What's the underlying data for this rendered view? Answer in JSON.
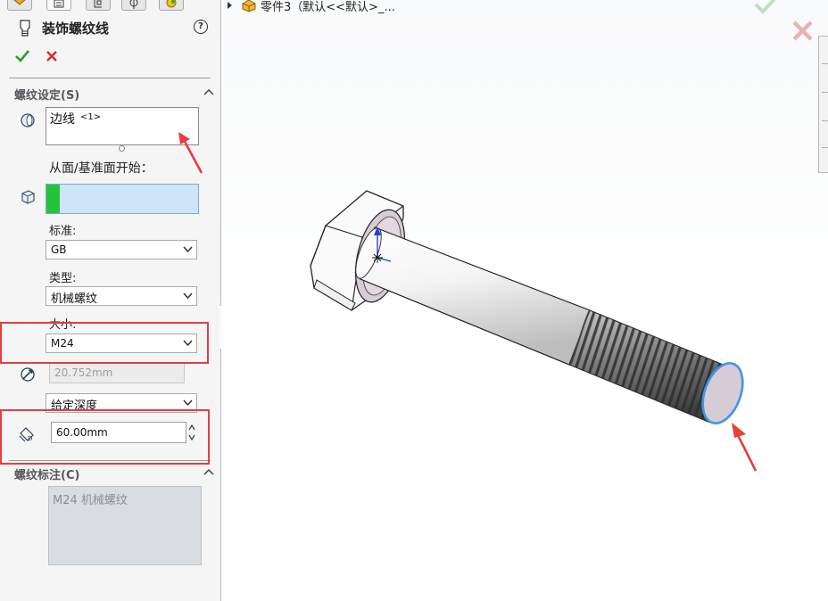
{
  "panel": {
    "title": "装饰螺纹线",
    "help": "?",
    "thread_settings": {
      "header": "螺纹设定(S)",
      "edge_value": "边线",
      "edge_suffix": "<1>",
      "start_label": "从面/基准面开始：",
      "standard_label": "标准:",
      "standard_value": "GB",
      "type_label": "类型:",
      "type_value": "机械螺纹",
      "size_label": "大小:",
      "size_value": "M24",
      "diameter_value": "20.752mm",
      "end_condition_value": "给定深度",
      "depth_value": "60.00mm"
    },
    "thread_callout": {
      "header": "螺纹标注(C)",
      "value": "M24 机械螺纹"
    }
  },
  "viewport": {
    "tree_item": "零件3（默认<<默认>_..."
  },
  "colors": {
    "highlight_red": "#e83d3d",
    "face_green": "#23c43a",
    "selection_blue": "#cfe4f8",
    "ok_green": "#2e9a36",
    "cancel_red": "#d62a20"
  }
}
